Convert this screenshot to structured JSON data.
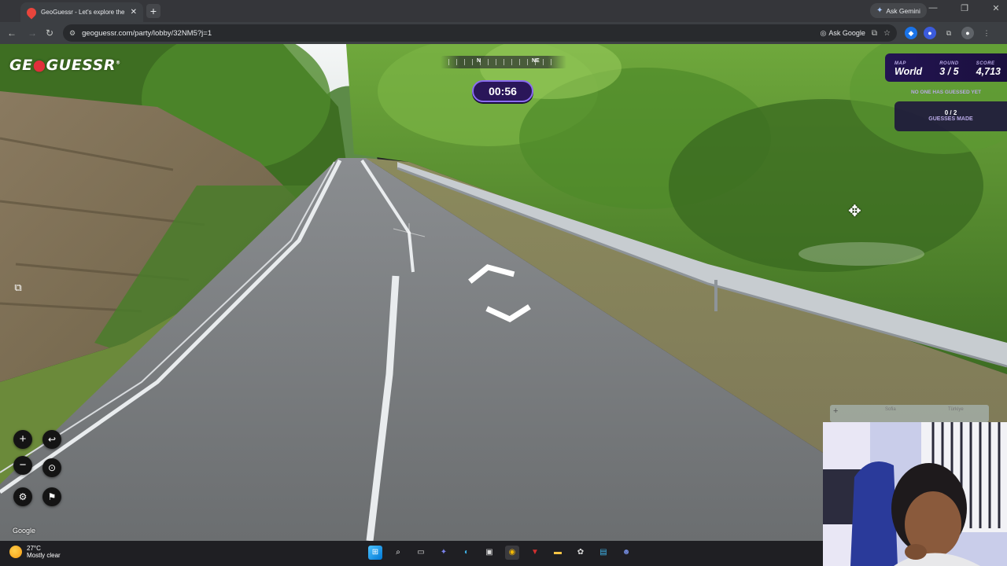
{
  "browser": {
    "tab_title": "GeoGuessr - Let's explore the w",
    "new_tab": "+",
    "ask_gemini": "Ask Gemini",
    "url": "geoguessr.com/party/lobby/32NM5?j=1",
    "ask_google": "Ask Google"
  },
  "game": {
    "logo_left": "GE",
    "logo_right": "GUESSR",
    "compass": {
      "n": "N",
      "ne": "NE"
    },
    "timer": "00:56",
    "hud": {
      "map_label": "MAP",
      "map_value": "World",
      "round_label": "ROUND",
      "round_value": "3 / 5",
      "score_label": "SCORE",
      "score_value": "4,713",
      "note": "NO ONE HAS GUESSED YET",
      "guesses_value": "0 / 2",
      "guesses_label": "GUESSES MADE"
    },
    "controls": {
      "zoom_in": "+",
      "zoom_out": "−",
      "undo": "↩",
      "checkpoint": "⊙",
      "settings": "⚙",
      "flag": "⚑"
    },
    "attribution": "Google",
    "minimap": {
      "plus": "+",
      "label_a": "Sofia",
      "label_b": "Türkiye"
    }
  },
  "taskbar": {
    "temp": "27°C",
    "condition": "Mostly clear"
  },
  "colors": {
    "hud_bg": "#231452",
    "timer_border": "#8a6cf0",
    "logo_pin": "#e02e3b"
  }
}
